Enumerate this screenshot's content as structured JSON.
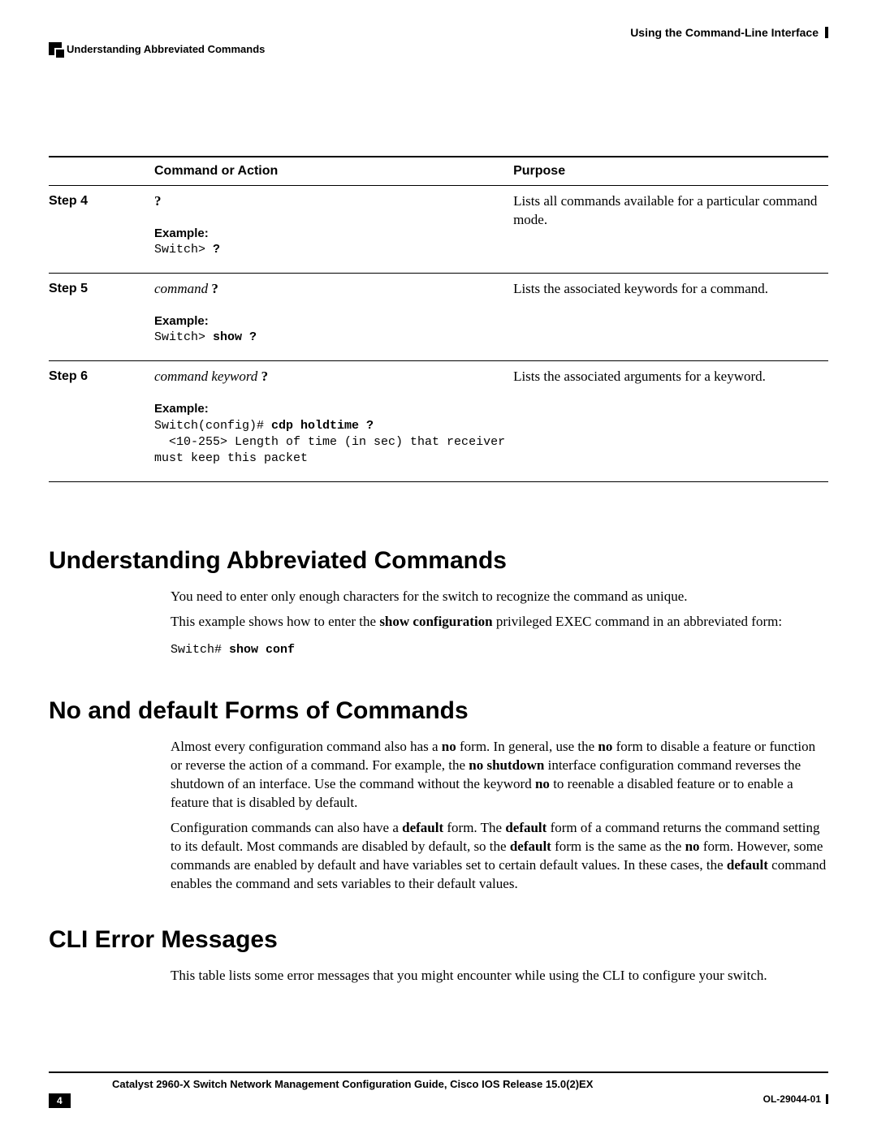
{
  "header": {
    "right": "Using the Command-Line Interface",
    "left": "Understanding Abbreviated Commands"
  },
  "table": {
    "headers": {
      "step": "",
      "command": "Command or Action",
      "purpose": "Purpose"
    },
    "rows": [
      {
        "step": "Step 4",
        "command_plain": "?",
        "example_label": "Example:",
        "example_prefix": "Switch> ",
        "example_bold": "?",
        "example_suffix": "",
        "purpose": "Lists all commands available for a particular command mode."
      },
      {
        "step": "Step 5",
        "command_italic": "command",
        "command_bold": " ?",
        "example_label": "Example:",
        "example_prefix": "Switch> ",
        "example_bold": "show ?",
        "example_suffix": "",
        "purpose": "Lists the associated keywords for a command."
      },
      {
        "step": "Step 6",
        "command_italic": "command keyword",
        "command_bold": " ?",
        "example_label": "Example:",
        "example_prefix": "Switch(config)# ",
        "example_bold": "cdp holdtime ?",
        "example_suffix": "\n  <10-255> Length of time (in sec) that receiver\nmust keep this packet",
        "purpose": "Lists the associated arguments for a keyword."
      }
    ]
  },
  "sections": {
    "abbrev": {
      "title": "Understanding Abbreviated Commands",
      "p1": "You need to enter only enough characters for the switch to recognize the command as unique.",
      "p2_pre": "This example shows how to enter the ",
      "p2_b": "show configuration",
      "p2_post": " privileged EXEC command in an abbreviated form:",
      "code_prefix": "Switch# ",
      "code_bold": "show conf"
    },
    "nodefault": {
      "title": "No and default Forms of Commands",
      "p1_a": "Almost every configuration command also has a ",
      "p1_b1": "no",
      "p1_c": " form. In general, use the ",
      "p1_b2": "no",
      "p1_d": " form to disable a feature or function or reverse the action of a command. For example, the ",
      "p1_b3": "no shutdown",
      "p1_e": " interface configuration command reverses the shutdown of an interface. Use the command without the keyword ",
      "p1_b4": "no",
      "p1_f": " to reenable a disabled feature or to enable a feature that is disabled by default.",
      "p2_a": "Configuration commands can also have a ",
      "p2_b1": "default",
      "p2_c": " form. The ",
      "p2_b2": "default",
      "p2_d": " form of a command returns the command setting to its default. Most commands are disabled by default, so the ",
      "p2_b3": "default",
      "p2_e": " form is the same as the ",
      "p2_b4": "no",
      "p2_f": " form. However, some commands are enabled by default and have variables set to certain default values. In these cases, the ",
      "p2_b5": "default",
      "p2_g": " command enables the command and sets variables to their default values."
    },
    "errors": {
      "title": "CLI Error Messages",
      "p1": "This table lists some error messages that you might encounter while using the CLI to configure your switch."
    }
  },
  "footer": {
    "title": "Catalyst 2960-X Switch Network Management Configuration Guide, Cisco IOS Release 15.0(2)EX",
    "page": "4",
    "docid": "OL-29044-01"
  }
}
